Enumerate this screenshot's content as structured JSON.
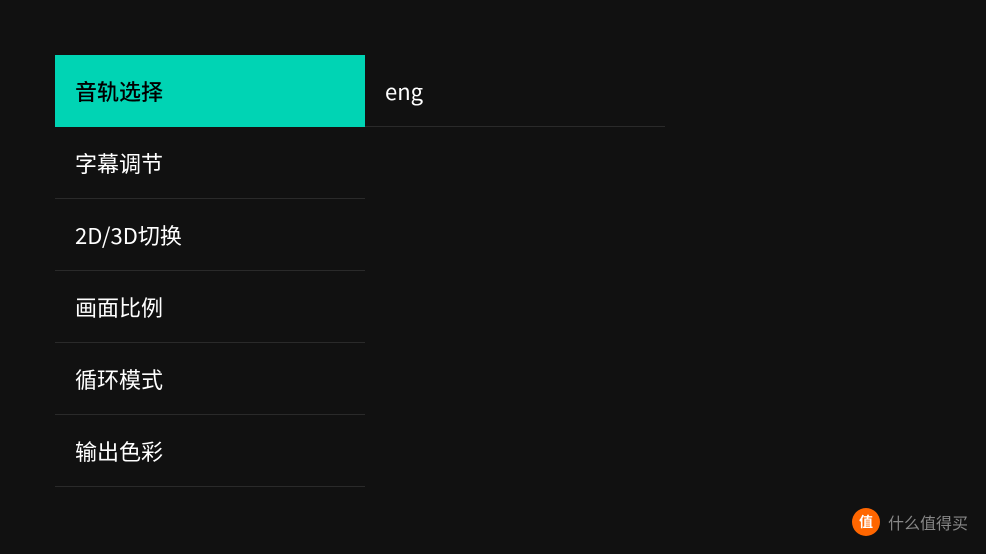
{
  "menu": {
    "items": [
      {
        "id": "audio-track",
        "label": "音轨选择",
        "active": true
      },
      {
        "id": "subtitle-adjust",
        "label": "字幕调节",
        "active": false
      },
      {
        "id": "2d3d-switch",
        "label": "2D/3D切换",
        "active": false
      },
      {
        "id": "aspect-ratio",
        "label": "画面比例",
        "active": false
      },
      {
        "id": "loop-mode",
        "label": "循环模式",
        "active": false
      },
      {
        "id": "output-color",
        "label": "输出色彩",
        "active": false
      }
    ]
  },
  "submenu": {
    "items": [
      {
        "id": "eng",
        "label": "eng"
      }
    ]
  },
  "watermark": {
    "icon_text": "值",
    "text": "什么值得买"
  },
  "colors": {
    "active_bg": "#00d4b4",
    "bg": "#111111",
    "text": "#ffffff",
    "active_text": "#000000",
    "divider": "#2a2a2a",
    "watermark_icon_bg": "#ff6600"
  }
}
